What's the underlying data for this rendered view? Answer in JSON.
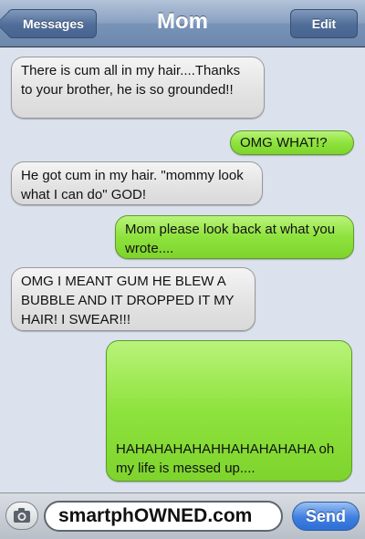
{
  "navbar": {
    "title": "Mom",
    "back_label": "Messages",
    "edit_label": "Edit"
  },
  "messages": [
    {
      "direction": "incoming",
      "text": "There is cum all in my hair....Thanks to your brother, he is so grounded!!"
    },
    {
      "direction": "outgoing",
      "text": "OMG WHAT!?"
    },
    {
      "direction": "incoming",
      "text": "He got cum in my hair. \"mommy look what I can do\" GOD!"
    },
    {
      "direction": "outgoing",
      "text": "Mom please look back at what you wrote...."
    },
    {
      "direction": "incoming",
      "text": "OMG I MEANT GUM HE BLEW A BUBBLE AND  IT DROPPED IT MY HAIR! I SWEAR!!!"
    },
    {
      "direction": "outgoing",
      "text": "HAHAHAHAHAHHAHAHAHAHA oh my life is messed up...."
    }
  ],
  "composer": {
    "input_value": "smartphOWNED.com",
    "send_label": "Send",
    "camera_icon": "camera-icon"
  },
  "colors": {
    "incoming_bubble": "#e2e2e2",
    "outgoing_bubble": "#8ee23d",
    "navbar": "#8aa2c2",
    "send_button": "#3f7fe0"
  }
}
